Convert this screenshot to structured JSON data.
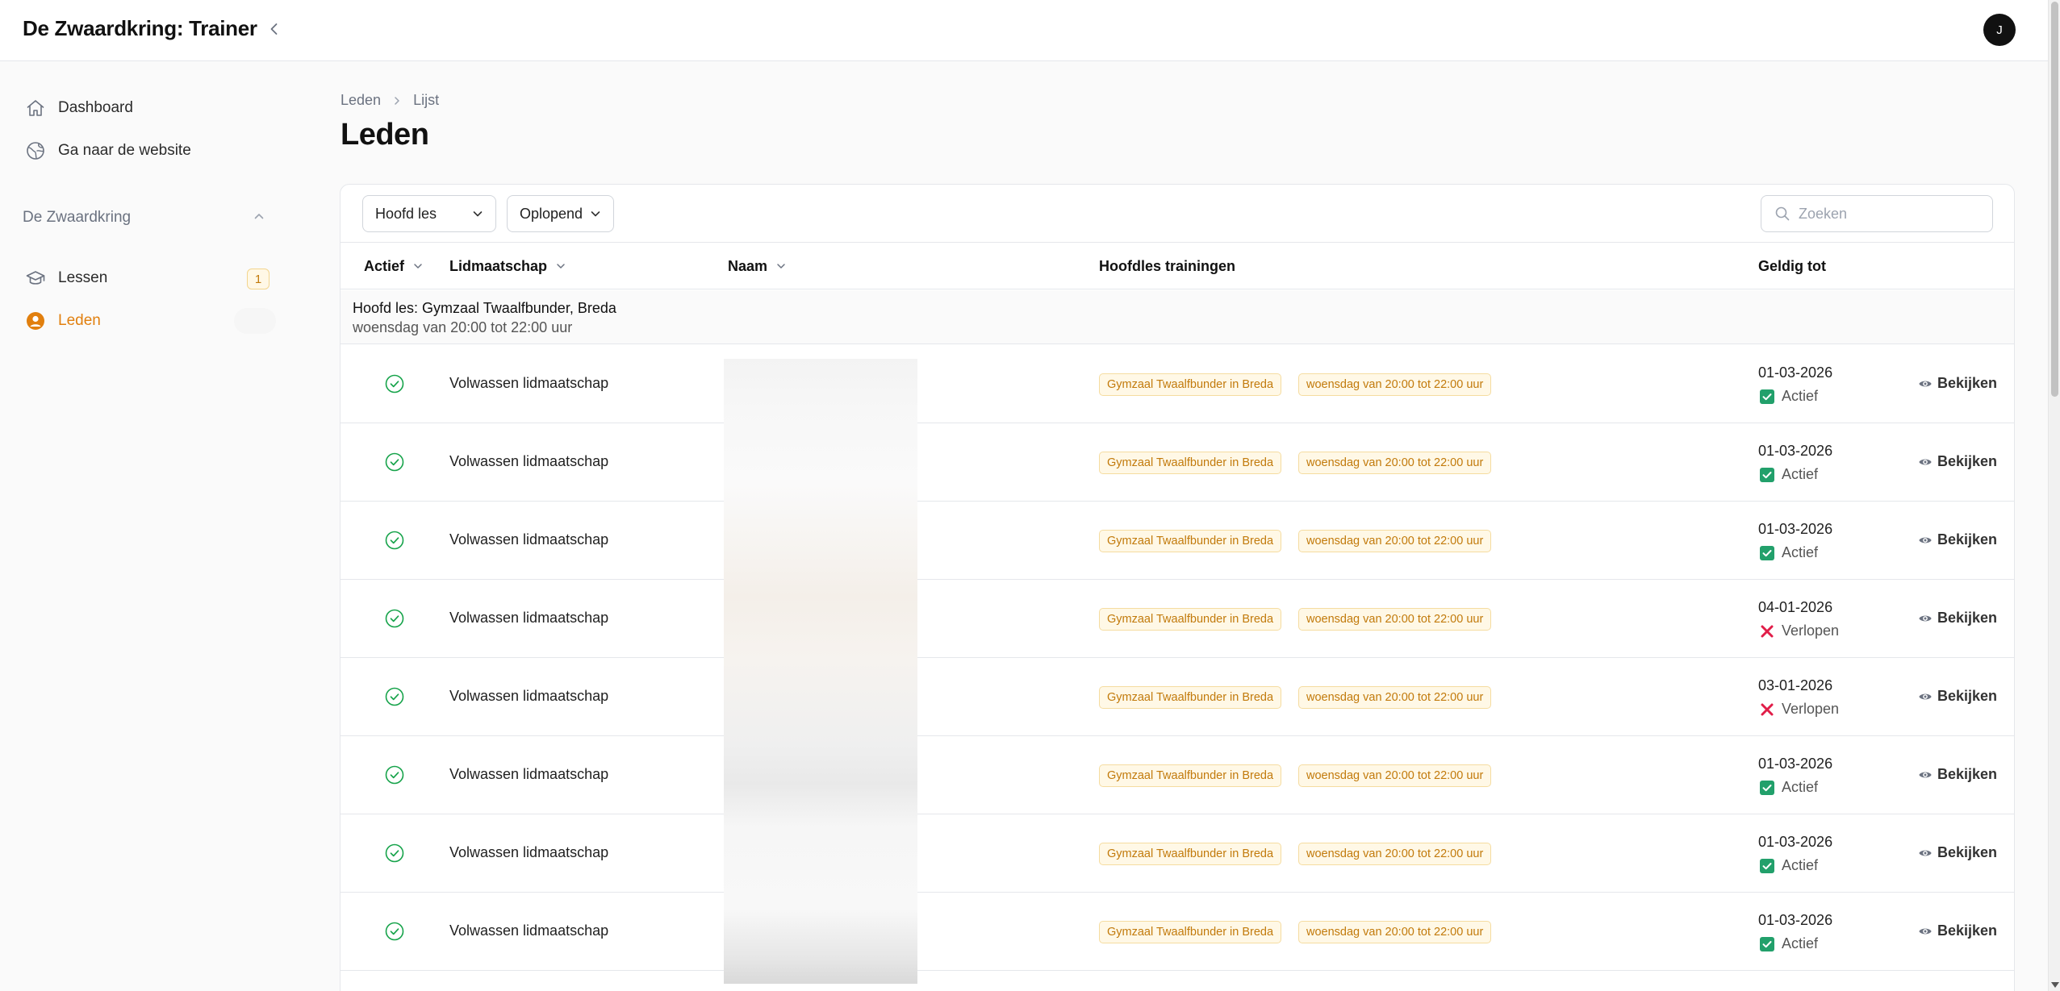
{
  "app": {
    "title": "De Zwaardkring: Trainer",
    "avatar_initial": "J"
  },
  "sidebar": {
    "items": [
      {
        "label": "Dashboard",
        "icon": "home-icon"
      },
      {
        "label": "Ga naar de website",
        "icon": "globe-icon"
      }
    ],
    "group": {
      "title": "De Zwaardkring",
      "items": [
        {
          "label": "Lessen",
          "icon": "graduation-cap-icon",
          "badge": "1"
        },
        {
          "label": "Leden",
          "icon": "user-circle-icon",
          "active": true
        }
      ]
    }
  },
  "breadcrumb": [
    "Leden",
    "Lijst"
  ],
  "page": {
    "title": "Leden"
  },
  "toolbar": {
    "group_select": "Hoofd les",
    "sort_select": "Oplopend",
    "search_placeholder": "Zoeken"
  },
  "columns": [
    "Actief",
    "Lidmaatschap",
    "Naam",
    "Hoofdles trainingen",
    "Geldig tot"
  ],
  "group": {
    "title": "Hoofd les: Gymzaal Twaalfbunder, Breda",
    "subtitle": "woensdag van 20:00 tot 22:00 uur"
  },
  "accent_color": "#e17f0e",
  "rows": [
    {
      "membership": "Volwassen lidmaatschap",
      "location": "Gymzaal Twaalfbunder in Breda",
      "schedule": "woensdag van 20:00 tot 22:00 uur",
      "valid_until": "01-03-2026",
      "status": "Actief",
      "status_type": "active",
      "action": "Bekijken"
    },
    {
      "membership": "Volwassen lidmaatschap",
      "location": "Gymzaal Twaalfbunder in Breda",
      "schedule": "woensdag van 20:00 tot 22:00 uur",
      "valid_until": "01-03-2026",
      "status": "Actief",
      "status_type": "active",
      "action": "Bekijken"
    },
    {
      "membership": "Volwassen lidmaatschap",
      "location": "Gymzaal Twaalfbunder in Breda",
      "schedule": "woensdag van 20:00 tot 22:00 uur",
      "valid_until": "01-03-2026",
      "status": "Actief",
      "status_type": "active",
      "action": "Bekijken"
    },
    {
      "membership": "Volwassen lidmaatschap",
      "location": "Gymzaal Twaalfbunder in Breda",
      "schedule": "woensdag van 20:00 tot 22:00 uur",
      "valid_until": "04-01-2026",
      "status": "Verlopen",
      "status_type": "expired",
      "action": "Bekijken"
    },
    {
      "membership": "Volwassen lidmaatschap",
      "location": "Gymzaal Twaalfbunder in Breda",
      "schedule": "woensdag van 20:00 tot 22:00 uur",
      "valid_until": "03-01-2026",
      "status": "Verlopen",
      "status_type": "expired",
      "action": "Bekijken"
    },
    {
      "membership": "Volwassen lidmaatschap",
      "location": "Gymzaal Twaalfbunder in Breda",
      "schedule": "woensdag van 20:00 tot 22:00 uur",
      "valid_until": "01-03-2026",
      "status": "Actief",
      "status_type": "active",
      "action": "Bekijken"
    },
    {
      "membership": "Volwassen lidmaatschap",
      "location": "Gymzaal Twaalfbunder in Breda",
      "schedule": "woensdag van 20:00 tot 22:00 uur",
      "valid_until": "01-03-2026",
      "status": "Actief",
      "status_type": "active",
      "action": "Bekijken"
    },
    {
      "membership": "Volwassen lidmaatschap",
      "location": "Gymzaal Twaalfbunder in Breda",
      "schedule": "woensdag van 20:00 tot 22:00 uur",
      "valid_until": "01-03-2026",
      "status": "Actief",
      "status_type": "active",
      "action": "Bekijken"
    }
  ]
}
